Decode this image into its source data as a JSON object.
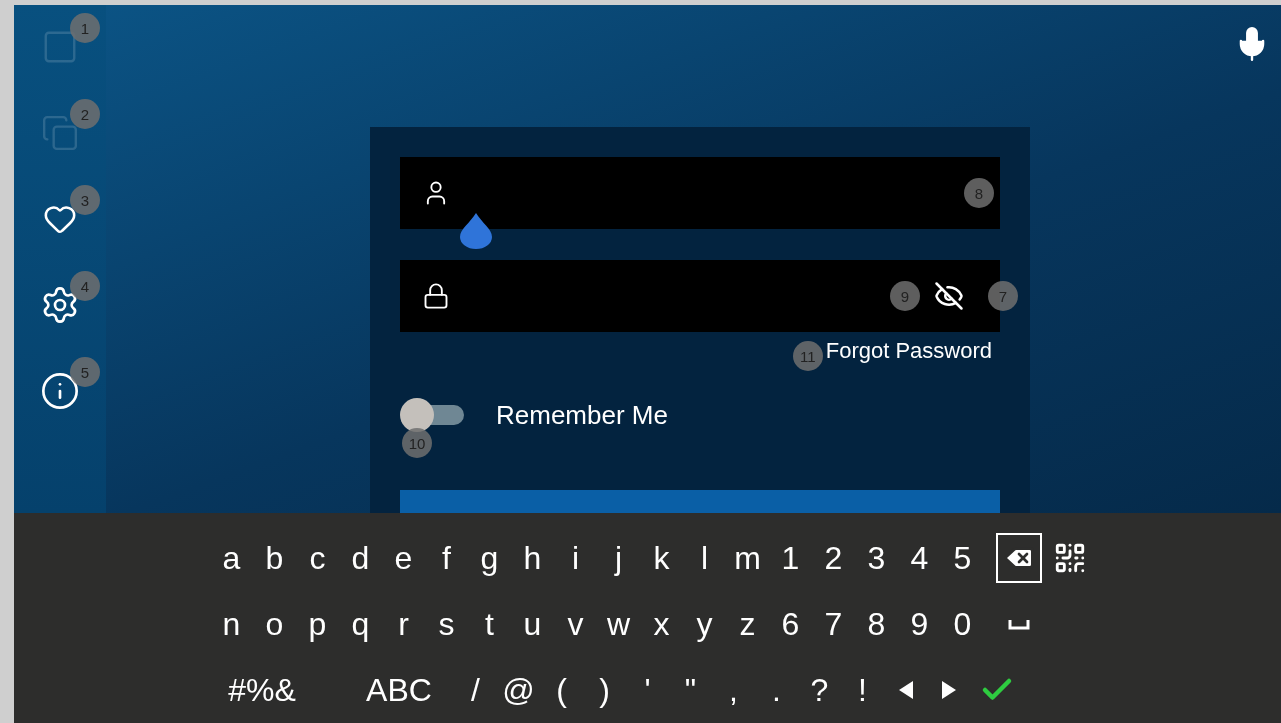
{
  "sidebar": {
    "items": [
      {
        "kind": "document",
        "disabled": true,
        "marker": "1"
      },
      {
        "kind": "gallery",
        "disabled": true,
        "marker": "2"
      },
      {
        "kind": "health",
        "disabled": false,
        "marker": "3"
      },
      {
        "kind": "settings",
        "disabled": false,
        "marker": "4"
      },
      {
        "kind": "info",
        "disabled": false,
        "marker": "5"
      }
    ]
  },
  "login": {
    "username": {
      "focused": true,
      "marker": "8"
    },
    "password": {
      "marker": "9",
      "reveal_marker": "7",
      "revealed": false
    },
    "forgot_password": {
      "label": "Forgot Password",
      "marker": "11"
    },
    "remember_me": {
      "label": "Remember Me",
      "on": false,
      "marker": "10"
    }
  },
  "keyboard": {
    "top_keys": [
      {
        "kind": "char",
        "label": "a",
        "selected": false
      },
      {
        "kind": "char",
        "label": "b",
        "selected": false
      },
      {
        "kind": "char",
        "label": "c",
        "selected": false
      },
      {
        "kind": "char",
        "label": "d",
        "selected": false
      },
      {
        "kind": "char",
        "label": "e",
        "selected": false
      },
      {
        "kind": "char",
        "label": "f",
        "selected": false
      },
      {
        "kind": "char",
        "label": "g",
        "selected": false
      },
      {
        "kind": "char",
        "label": "h",
        "selected": false
      },
      {
        "kind": "char",
        "label": "i",
        "selected": false
      },
      {
        "kind": "char",
        "label": "j",
        "selected": false
      },
      {
        "kind": "char",
        "label": "k",
        "selected": false
      },
      {
        "kind": "char",
        "label": "l",
        "selected": false
      },
      {
        "kind": "char",
        "label": "m",
        "selected": false
      },
      {
        "kind": "char",
        "label": "1",
        "selected": false
      },
      {
        "kind": "char",
        "label": "2",
        "selected": false
      },
      {
        "kind": "char",
        "label": "3",
        "selected": false
      },
      {
        "kind": "char",
        "label": "4",
        "selected": false
      },
      {
        "kind": "char",
        "label": "5",
        "selected": false
      },
      {
        "kind": "backspace",
        "selected": true
      },
      {
        "kind": "qr",
        "selected": false
      }
    ],
    "middle_keys": [
      {
        "kind": "char",
        "label": "n",
        "selected": false
      },
      {
        "kind": "char",
        "label": "o",
        "selected": false
      },
      {
        "kind": "char",
        "label": "p",
        "selected": false
      },
      {
        "kind": "char",
        "label": "q",
        "selected": false
      },
      {
        "kind": "char",
        "label": "r",
        "selected": false
      },
      {
        "kind": "char",
        "label": "s",
        "selected": false
      },
      {
        "kind": "char",
        "label": "t",
        "selected": false
      },
      {
        "kind": "char",
        "label": "u",
        "selected": false
      },
      {
        "kind": "char",
        "label": "v",
        "selected": false
      },
      {
        "kind": "char",
        "label": "w",
        "selected": false
      },
      {
        "kind": "char",
        "label": "x",
        "selected": false
      },
      {
        "kind": "char",
        "label": "y",
        "selected": false
      },
      {
        "kind": "char",
        "label": "z",
        "selected": false
      },
      {
        "kind": "char",
        "label": "6",
        "selected": false
      },
      {
        "kind": "char",
        "label": "7",
        "selected": false
      },
      {
        "kind": "char",
        "label": "8",
        "selected": false
      },
      {
        "kind": "char",
        "label": "9",
        "selected": false
      },
      {
        "kind": "char",
        "label": "0",
        "selected": false
      },
      {
        "kind": "space",
        "selected": false
      }
    ],
    "bottom_keys": [
      {
        "kind": "wide",
        "label": "#%&",
        "selected": false
      },
      {
        "kind": "wide",
        "label": "ABC",
        "selected": false
      },
      {
        "kind": "char",
        "label": "/",
        "selected": false
      },
      {
        "kind": "char",
        "label": "@",
        "selected": false
      },
      {
        "kind": "char",
        "label": "(",
        "selected": false
      },
      {
        "kind": "char",
        "label": ")",
        "selected": false
      },
      {
        "kind": "char",
        "label": "'",
        "selected": false
      },
      {
        "kind": "char",
        "label": "\"",
        "selected": false
      },
      {
        "kind": "char",
        "label": ",",
        "selected": false
      },
      {
        "kind": "char",
        "label": ".",
        "selected": false
      },
      {
        "kind": "char",
        "label": "?",
        "selected": false
      },
      {
        "kind": "char",
        "label": "!",
        "selected": false
      },
      {
        "kind": "left",
        "selected": false
      },
      {
        "kind": "right",
        "selected": false
      },
      {
        "kind": "enter",
        "selected": false
      }
    ]
  }
}
